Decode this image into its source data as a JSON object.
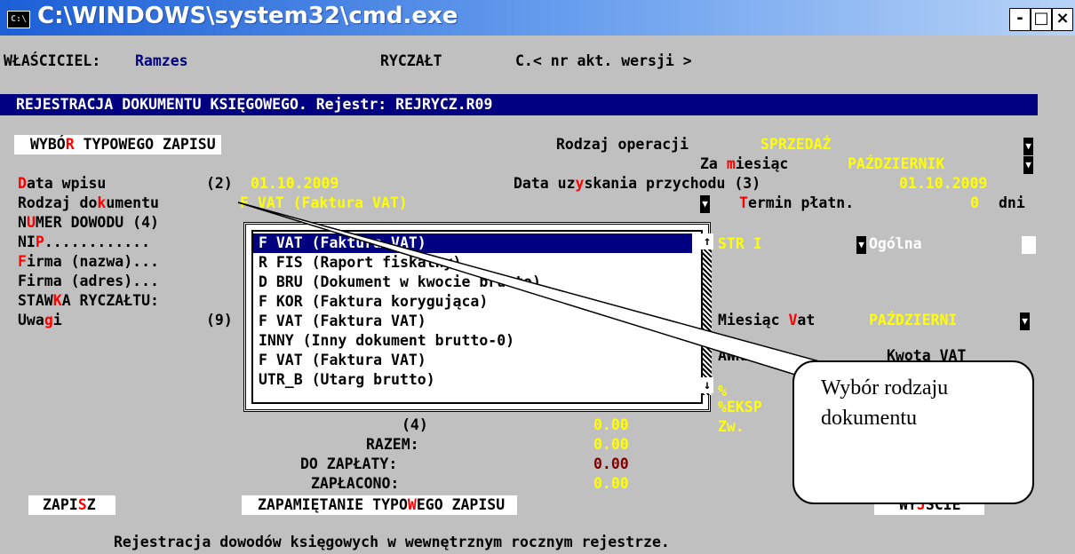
{
  "window": {
    "title": "C:\\WINDOWS\\system32\\cmd.exe",
    "icon_text": "C:\\",
    "btn_min": "-",
    "btn_max": "□",
    "btn_close": "×"
  },
  "top": {
    "owner_label": "WŁAŚCICIEL:",
    "owner_value": "Ramzes",
    "mode": "RYCZAŁT",
    "version": "C.< nr akt. wersji >"
  },
  "header": "REJESTRACJA DOKUMENTU KSIĘGOWEGO. Rejestr: REJRYCZ.R09",
  "typical_button": {
    "a": "WYBÓ",
    "b": "R",
    "c": " TYPOWEGO ZAPISU"
  },
  "operation": {
    "label": "Rodzaj operacji",
    "value": "SPRZEDAŻ"
  },
  "month": {
    "a": "Za ",
    "b": "m",
    "c": "iesiąc",
    "value": "PAŹDZIERNIK"
  },
  "entry_date": {
    "a": "D",
    "b": "ata wpisu",
    "num": "(2)",
    "value": "01.10.2009"
  },
  "income_date": {
    "a": "Data uz",
    "b": "y",
    "c": "skania przychodu (3)",
    "value": "01.10.2009"
  },
  "doc_type": {
    "a": "Rodzaj do",
    "b": "k",
    "c": "umentu",
    "value": "F VAT (Faktura VAT)"
  },
  "payment": {
    "a": "T",
    "b": "ermin płatn.",
    "value": "0",
    "unit": "dni"
  },
  "doc_number": {
    "a": "N",
    "b": "U",
    "c": "MER DOWODU (4)"
  },
  "nip": {
    "a": "NI",
    "b": "P",
    "c": "............"
  },
  "company_name": {
    "a": "F",
    "b": "irma (nazwa)..."
  },
  "company_address": "Firma (adres)...",
  "rate": {
    "a": "STAW",
    "b": "K",
    "c": "A RYCZAŁTU:"
  },
  "notes": {
    "a": "Uwa",
    "b": "g",
    "c": "i",
    "num": "(9)"
  },
  "right_fields": {
    "str": "STR I",
    "general": "Ogólna",
    "vat_month_a": "Miesiąc ",
    "vat_month_b": "V",
    "vat_month_c": "at",
    "vat_month_value": "PAŹDZIERNI",
    "rate_col": "AWKA",
    "vat_amount": "Kwota VAT",
    "pct": "%",
    "eksp": "%EKSP",
    "zw": "Zw."
  },
  "dropdown": {
    "items": [
      "F VAT (Faktura VAT)",
      "R FIS (Raport fiskalny)",
      "D BRU (Dokument w kwocie brutto)",
      "F KOR (Faktura korygująca)",
      "F VAT (Faktura VAT)",
      "INNY (Inny dokument brutto-0)",
      "F VAT (Faktura VAT)",
      "UTR_B (Utarg brutto)"
    ],
    "scroll_up": "↑",
    "scroll_down": "↓"
  },
  "totals": {
    "row4_label": "(4)",
    "row4_value": "0.00",
    "sum_label": "RAZEM:",
    "sum_value": "0.00",
    "topay_label": "DO ZAPŁATY:",
    "topay_value": "0.00",
    "paid_label": "ZAPŁACONO:",
    "paid_value": "0.00"
  },
  "buttons": {
    "save_a": "ZAPI",
    "save_b": "S",
    "save_c": "Z",
    "remember_a": "ZAPAMIĘTANIE TYPO",
    "remember_b": "W",
    "remember_c": "EGO ZAPISU",
    "exit_a": "WY",
    "exit_b": "J",
    "exit_c": "ŚCIE"
  },
  "status": "Rejestracja dowodów księgowych w wewnętrznym rocznym rejestrze.",
  "callout": "Wybór rodzaju\ndokumentu"
}
